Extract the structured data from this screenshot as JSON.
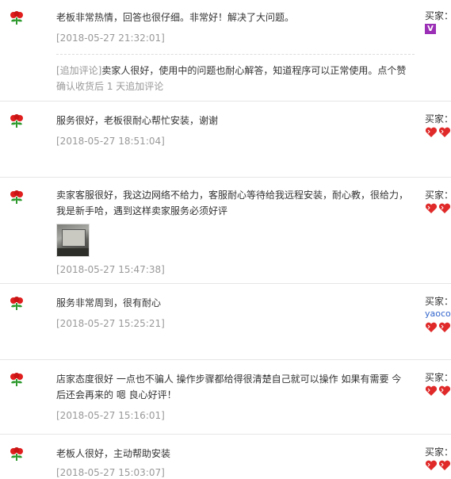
{
  "reviews": [
    {
      "text": "老板非常热情，回答也很仔细。非常好！解决了大问题。",
      "date": "[2018-05-27 21:32:01]",
      "append": {
        "tag": "[追加评论]",
        "text": "卖家人很好，使用中的问题也耐心解答，知道程序可以正常使用。点个赞",
        "sub": "确认收货后 1 天追加评论"
      },
      "buyer_label": "买家：",
      "buyer_badge": "V"
    },
    {
      "text": "服务很好，老板很耐心帮忙安装，谢谢",
      "date": "[2018-05-27 18:51:04]",
      "buyer_label": "买家："
    },
    {
      "text_line1": "卖家客服很好，我这边网络不给力，客服耐心等待给我远程安装，耐心教，很给力，",
      "text_line2": "我是新手哈，遇到这样卖家服务必须好评",
      "date": "[2018-05-27 15:47:38]",
      "buyer_label": "买家："
    },
    {
      "text": "服务非常周到，很有耐心",
      "date": "[2018-05-27 15:25:21]",
      "buyer_label": "买家：",
      "buyer_name": "yaoco"
    },
    {
      "text_line1": "店家态度很好 一点也不骗人 操作步骤都给得很清楚自己就可以操作 如果有需要 今",
      "text_line2": "后还会再来的 嗯 良心好评！",
      "date": "[2018-05-27 15:16:01]",
      "buyer_label": "买家："
    },
    {
      "text": "老板人很好，主动帮助安装",
      "date": "[2018-05-27 15:03:07]",
      "buyer_label": "买家："
    }
  ],
  "icons": {
    "rating_icon": "rose-icon",
    "buyer_level_icon": "heart-icon"
  },
  "colors": {
    "text": "#333333",
    "date": "#999999",
    "divider": "#e6e6e6",
    "rose_red": "#e01e1e",
    "leaf_green": "#2e9a2e",
    "heart_red": "#e02a2a",
    "link_blue": "#3366cc"
  }
}
